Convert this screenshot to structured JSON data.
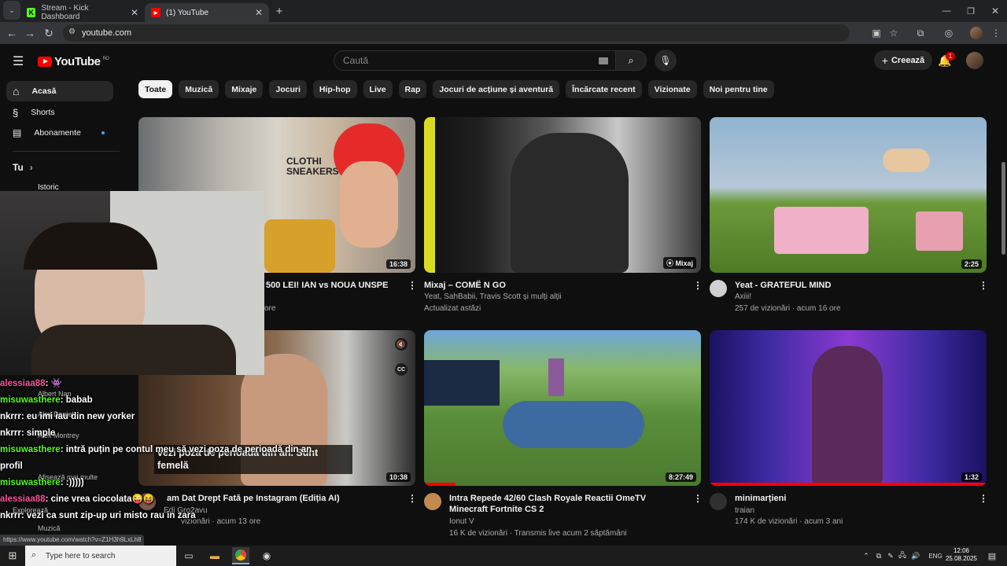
{
  "browser": {
    "tabs": [
      {
        "title": "Stream - Kick Dashboard",
        "icon": "kick-icon",
        "color": "#53fc18"
      },
      {
        "title": "(1) YouTube",
        "icon": "youtube-icon",
        "color": "#ff0000"
      }
    ],
    "url": "youtube.com",
    "status_url": "https://www.youtube.com/watch?v=Z1H3h9LxLh8"
  },
  "youtube": {
    "logo_text": "YouTube",
    "region": "RO",
    "search_placeholder": "Caută",
    "create_label": "Creează",
    "notification_count": "1",
    "chips": [
      "Toate",
      "Muzică",
      "Mixaje",
      "Jocuri",
      "Hip-hop",
      "Live",
      "Rap",
      "Jocuri de acțiune și aventură",
      "Încărcate recent",
      "Vizionate",
      "Noi pentru tine"
    ],
    "sidebar": [
      {
        "label": "Acasă",
        "icon": "home-icon"
      },
      {
        "label": "Shorts",
        "icon": "shorts-icon"
      },
      {
        "label": "Abonamente",
        "icon": "subscriptions-icon"
      }
    ],
    "you_label": "Tu",
    "history_label": "Istoric",
    "sidebar_extra": {
      "sub1": "Albert Nan",
      "sub2": "Alex Daniel",
      "sub3": "Alex Montrey",
      "show_more": "Afișează mai multe",
      "explore": "Explorează",
      "music": "Muzică"
    },
    "videos": [
      {
        "title": "500 LEI! IAN vs NOUA UNSPE",
        "channel": "",
        "meta": "ore",
        "duration": "16:38"
      },
      {
        "title": "Mixaj – COMË N GO",
        "channel": "Yeat, SahBabii, Travis Scott și mulți alții",
        "meta": "Actualizat astăzi",
        "duration": "Mixaj"
      },
      {
        "title": "Yeat - GRATEFUL MIND",
        "channel": "Axiii!",
        "meta": "257 de vizionări · acum 16 ore",
        "duration": "2:25"
      },
      {
        "title": "am Dat Drept Fată pe Instagram (Ediția AI)",
        "channel": "Edi Gro2avu",
        "meta": "vizionări · acum 13 ore",
        "duration": "10:38"
      },
      {
        "title": "Intra Repede  42/60  Clash Royale  Reactii  OmeTV  Minecraft  Fortnite  CS 2",
        "channel": "Ionut V",
        "meta": "16 K de vizionări · Transmis live acum 2 săptămâni",
        "duration": "8:27:49"
      },
      {
        "title": "minimarțieni",
        "channel": "traian",
        "meta": "174 K de vizionări · acum 3 ani",
        "duration": "1:32"
      }
    ],
    "caption": "vezi poza de perioadă din an. Sunt femelă"
  },
  "stream_overlay": {
    "chat": [
      {
        "user": "alessiaa88",
        "text": ": 👾",
        "color": "#ff4fa0"
      },
      {
        "user": "misuwasthere",
        "text": ": babab",
        "color": "#53fc18"
      },
      {
        "user": "nkrrr",
        "text": ": eu imi iau din new yorker",
        "color": "#ffffff"
      },
      {
        "user": "nkrrr",
        "text": ": simple",
        "color": "#ffffff"
      },
      {
        "user": "misuwasthere",
        "text": ": intră puțin pe contul meu să vezi poza de perioadă din an.",
        "color": "#53fc18"
      },
      {
        "user": "profil",
        "text": "",
        "color": "#ffffff"
      },
      {
        "user": "misuwasthere",
        "text": ": :)))))",
        "color": "#53fc18"
      },
      {
        "user": "alessiaa88",
        "text": ": cine vrea ciocolata😜😝",
        "color": "#ff4fa0"
      },
      {
        "user": "nkrrr",
        "text": ": vezi ca sunt zip-up uri misto rau in zara",
        "color": "#ffffff"
      }
    ]
  },
  "taskbar": {
    "search_placeholder": "Type here to search",
    "language": "ENG",
    "time": "12:06",
    "date": "25.08.2025"
  }
}
